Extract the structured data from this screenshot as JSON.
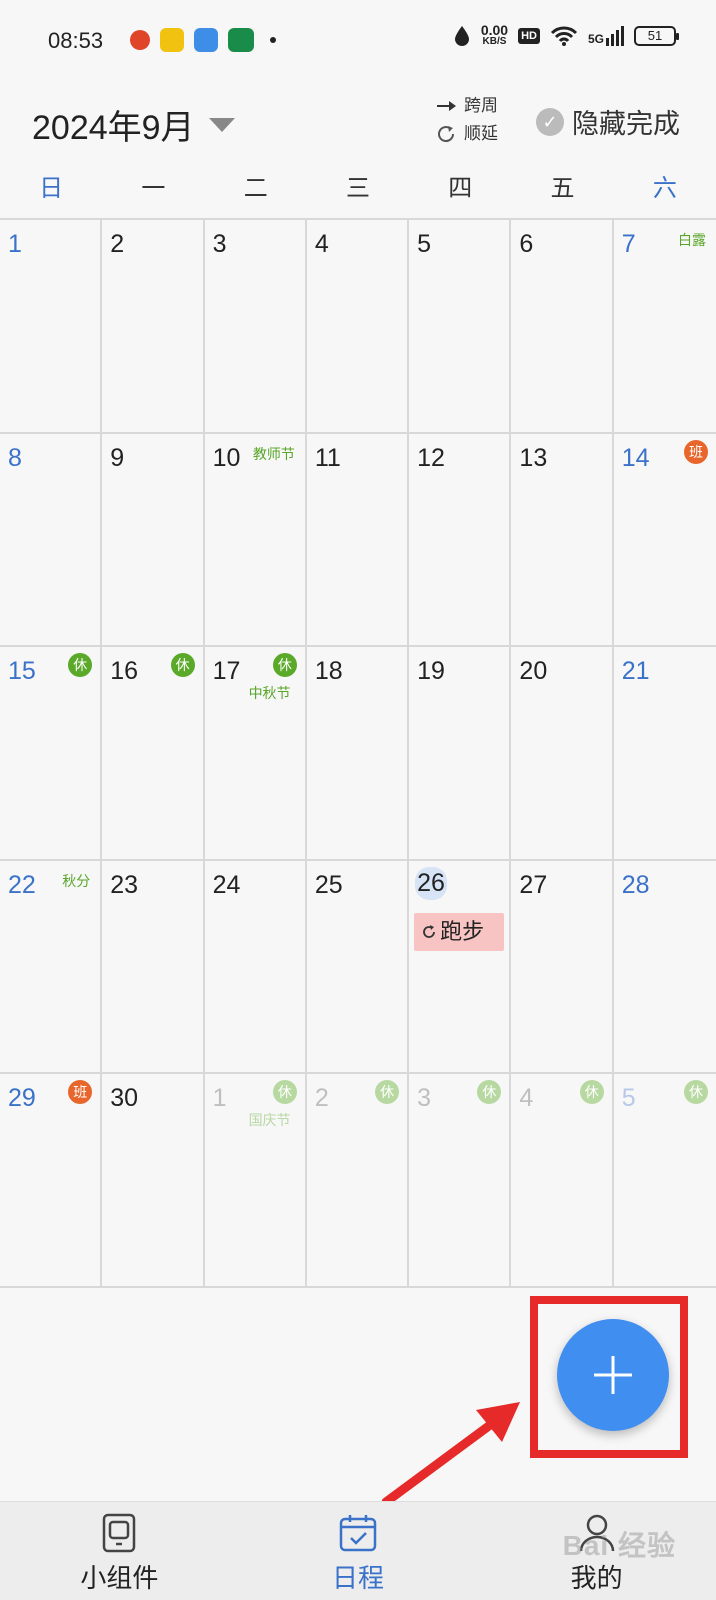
{
  "status_bar": {
    "time": "08:53",
    "net_speed": "0.00",
    "net_unit": "KB/S",
    "hd": "HD",
    "signal": "5G",
    "battery": "51"
  },
  "header": {
    "month_title": "2024年9月",
    "opt_cross_week": "跨周",
    "opt_postpone": "顺延",
    "hide_completed": "隐藏完成"
  },
  "weekdays": [
    "日",
    "一",
    "二",
    "三",
    "四",
    "五",
    "六"
  ],
  "days": [
    {
      "n": "1"
    },
    {
      "n": "2"
    },
    {
      "n": "3"
    },
    {
      "n": "4"
    },
    {
      "n": "5"
    },
    {
      "n": "6"
    },
    {
      "n": "7",
      "term": "白露"
    },
    {
      "n": "8"
    },
    {
      "n": "9"
    },
    {
      "n": "10",
      "term": "教师节"
    },
    {
      "n": "11"
    },
    {
      "n": "12"
    },
    {
      "n": "13"
    },
    {
      "n": "14",
      "badge": "班"
    },
    {
      "n": "15",
      "badge": "休"
    },
    {
      "n": "16",
      "badge": "休"
    },
    {
      "n": "17",
      "badge": "休",
      "term": "中秋节"
    },
    {
      "n": "18"
    },
    {
      "n": "19"
    },
    {
      "n": "20"
    },
    {
      "n": "21"
    },
    {
      "n": "22",
      "term": "秋分"
    },
    {
      "n": "23"
    },
    {
      "n": "24"
    },
    {
      "n": "25"
    },
    {
      "n": "26",
      "today": true,
      "event": "跑步"
    },
    {
      "n": "27"
    },
    {
      "n": "28"
    },
    {
      "n": "29",
      "badge": "班"
    },
    {
      "n": "30"
    },
    {
      "n": "1",
      "other": true,
      "badge": "休",
      "term": "国庆节"
    },
    {
      "n": "2",
      "other": true,
      "badge": "休"
    },
    {
      "n": "3",
      "other": true,
      "badge": "休"
    },
    {
      "n": "4",
      "other": true,
      "badge": "休"
    },
    {
      "n": "5",
      "other": true,
      "badge": "休"
    }
  ],
  "bottom_nav": {
    "widgets": "小组件",
    "schedule": "日程",
    "mine": "我的"
  },
  "watermark": "Bai 经验",
  "colors": {
    "accent_blue": "#3b72c9",
    "fab_blue": "#3f8ef0",
    "rest_badge": "#5aa928",
    "work_badge": "#e8662c",
    "term_green": "#58a628",
    "event_bg": "#f7c3c3",
    "highlight_red": "#e62a2a"
  }
}
